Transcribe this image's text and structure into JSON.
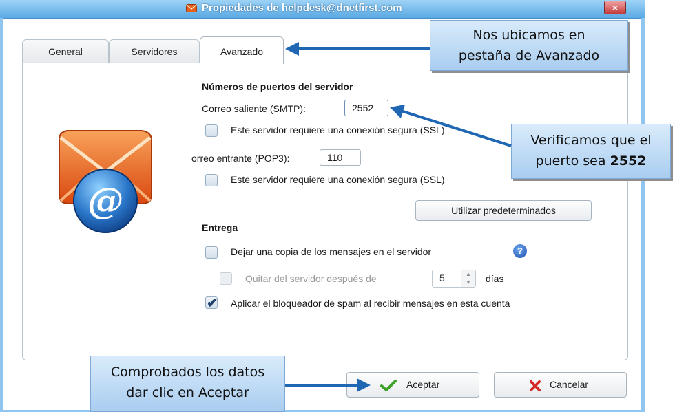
{
  "window": {
    "title": "Propiedades de helpdesk@dnetfirst.com",
    "close_label": "×"
  },
  "tabs": [
    {
      "label": "General"
    },
    {
      "label": "Servidores"
    },
    {
      "label": "Avanzado",
      "active": true
    }
  ],
  "ports": {
    "heading": "Números de puertos del servidor",
    "smtp_label": "Correo saliente (SMTP):",
    "smtp_value": "2552",
    "smtp_ssl_label": "Este servidor requiere una conexión segura (SSL)",
    "smtp_ssl_checked": false,
    "pop3_label": "orreo entrante (POP3):",
    "pop3_value": "110",
    "pop3_ssl_label": "Este servidor requiere una conexión segura (SSL)",
    "pop3_ssl_checked": false,
    "defaults_button": "Utilizar predeterminados"
  },
  "delivery": {
    "heading": "Entrega",
    "leave_copy_label": "Dejar una copia de los mensajes en el servidor",
    "leave_copy_checked": false,
    "help_glyph": "?",
    "remove_after_label": "Quitar del servidor después de",
    "remove_after_checked": false,
    "remove_after_days": "5",
    "days_label": "días",
    "spam_label": "Aplicar el bloqueador de spam al recibir mensajes en esta cuenta",
    "spam_checked": true
  },
  "buttons": {
    "ok_label": "Aceptar",
    "cancel_label": "Cancelar"
  },
  "annotations": {
    "tab_note_line1": "Nos ubicamos en",
    "tab_note_line2": "pestaña de Avanzado",
    "port_note_line1": "Verificamos que el",
    "port_note_line2_prefix": "puerto sea",
    "port_note_line2_value": "2552",
    "accept_note_line1": "Comprobados los datos",
    "accept_note_line2": "dar clic en Aceptar"
  },
  "icons": {
    "title": "envelope-icon",
    "mail": "mail-at-icon",
    "ok": "checkmark-icon",
    "cancel": "x-icon",
    "help": "help-icon"
  },
  "colors": {
    "titlebar": "#5aa9e3",
    "callout": "#a9cdf0",
    "arrow": "#1f66b3",
    "envelope": "#e8601c",
    "at_badge": "#2a76c9"
  }
}
